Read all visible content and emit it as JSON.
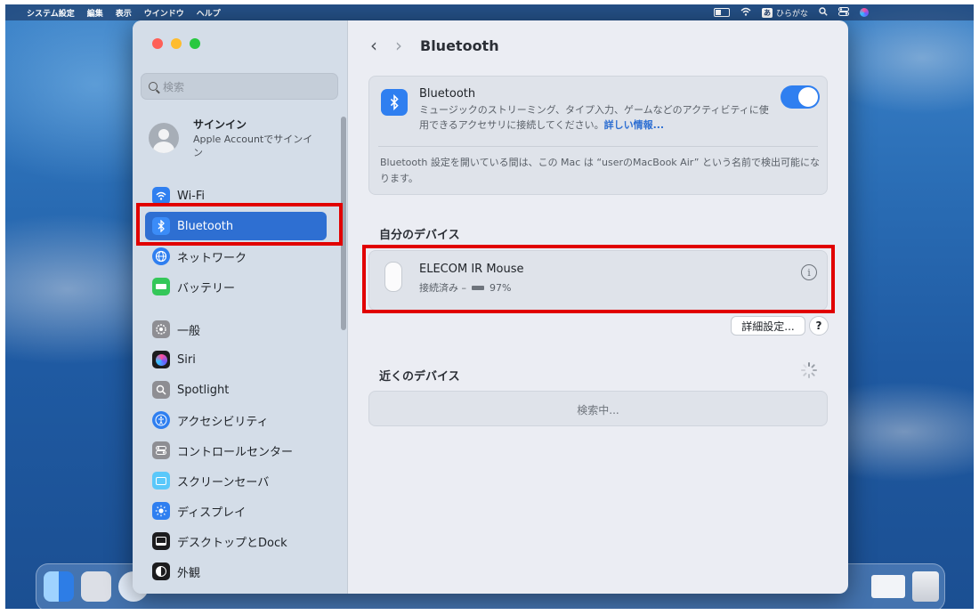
{
  "menubar": {
    "app_name": "システム設定",
    "menus": [
      "編集",
      "表示",
      "ウインドウ",
      "ヘルプ"
    ],
    "input_mode_badge": "あ",
    "input_mode_label": "ひらがな"
  },
  "sidebar": {
    "search_placeholder": "検索",
    "account": {
      "title": "サインイン",
      "subtitle": "Apple Accountでサインイン"
    },
    "items": [
      {
        "label": "Wi-Fi",
        "icon": "wifi-icon",
        "color": "#2f7ff0"
      },
      {
        "label": "Bluetooth",
        "icon": "bluetooth-icon",
        "color": "#2f7ff0",
        "selected": true
      },
      {
        "label": "ネットワーク",
        "icon": "globe-icon",
        "color": "#2f7ff0"
      },
      {
        "label": "バッテリー",
        "icon": "battery-icon",
        "color": "#34c759"
      },
      {
        "label": "一般",
        "icon": "gear-icon",
        "color": "#8e8e93"
      },
      {
        "label": "Siri",
        "icon": "siri-icon",
        "color": "#1c1c1e"
      },
      {
        "label": "Spotlight",
        "icon": "spotlight-icon",
        "color": "#8e8e93"
      },
      {
        "label": "アクセシビリティ",
        "icon": "accessibility-icon",
        "color": "#2f7ff0"
      },
      {
        "label": "コントロールセンター",
        "icon": "control-center-icon",
        "color": "#8e8e93"
      },
      {
        "label": "スクリーンセーバ",
        "icon": "screensaver-icon",
        "color": "#5ac8fa"
      },
      {
        "label": "ディスプレイ",
        "icon": "display-icon",
        "color": "#2f7ff0"
      },
      {
        "label": "デスクトップとDock",
        "icon": "dock-icon",
        "color": "#1c1c1e"
      },
      {
        "label": "外観",
        "icon": "appearance-icon",
        "color": "#1c1c1e"
      }
    ]
  },
  "main": {
    "title": "Bluetooth",
    "bluetooth_card": {
      "title": "Bluetooth",
      "description": "ミュージックのストリーミング、タイプ入力、ゲームなどのアクティビティに使用できるアクセサリに接続してください。",
      "more_info_link": "詳しい情報...",
      "toggle_on": true,
      "note": "Bluetooth 設定を開いている間は、この Mac は “userのMacBook Air” という名前で検出可能になります。"
    },
    "my_devices": {
      "section_title": "自分のデバイス",
      "devices": [
        {
          "name": "ELECOM IR Mouse",
          "status": "接続済み –",
          "battery": "97%"
        }
      ]
    },
    "advanced_button": "詳細設定...",
    "help_button": "?",
    "nearby_devices": {
      "section_title": "近くのデバイス",
      "searching": "検索中..."
    }
  },
  "colors": {
    "accent": "#2e6fd2",
    "highlight_box": "#e10000"
  }
}
